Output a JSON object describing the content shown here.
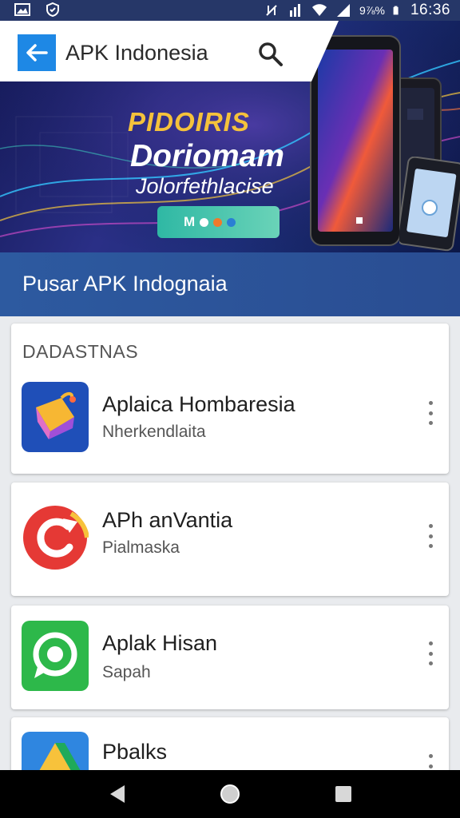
{
  "status_bar": {
    "battery_text": "9⅞%",
    "time": "16:36",
    "icons": [
      "image-icon",
      "shield-icon",
      "mute-icon",
      "signal-icon",
      "wifi-icon",
      "cell-icon",
      "battery-icon"
    ]
  },
  "app_bar": {
    "title": "APK Indonesia",
    "back_icon": "arrow-left-icon",
    "search_icon": "search-icon"
  },
  "banner": {
    "kicker": "PIDOIRIS",
    "title": "Doriomam",
    "subtitle": "Jolorfethlacise",
    "button_label": "M",
    "dot_colors": [
      "#ffffff",
      "#f07a2c",
      "#2a7fd4"
    ]
  },
  "section": {
    "title": "Pusar APK Indognaia"
  },
  "list": {
    "header": "DADASTNAS",
    "items": [
      {
        "name": "Aplaica Hombaresia",
        "subtitle": "Nherkendlaita",
        "icon": "gift-box-icon",
        "icon_color": "#1f4fb8"
      },
      {
        "name": "APh anVantia",
        "subtitle": "Pialmaska",
        "icon": "refresh-icon",
        "icon_color": "#e53935"
      },
      {
        "name": "Aplak Hisan",
        "subtitle": "Sapah",
        "icon": "chat-bubble-icon",
        "icon_color": "#2db84a"
      },
      {
        "name": "Pbalks",
        "subtitle": "",
        "icon": "drive-triangle-icon",
        "icon_color": "#2f86e0"
      }
    ]
  },
  "nav_bar": {
    "back": "nav-back-icon",
    "home": "nav-home-icon",
    "recents": "nav-recents-icon"
  },
  "colors": {
    "accent": "#1e88e5",
    "section_bg": "#2d5aa0",
    "status_bar": "#263768"
  }
}
